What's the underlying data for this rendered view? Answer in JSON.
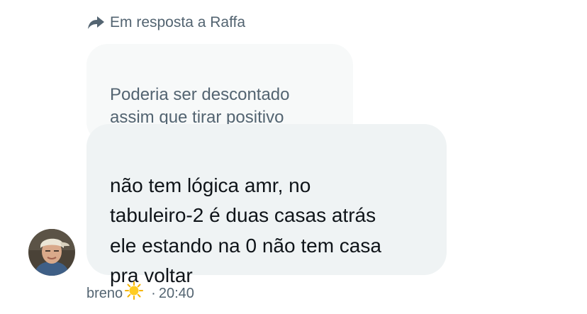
{
  "reply_context": {
    "icon": "reply-arrow-icon",
    "text": "Em resposta a Raffa"
  },
  "quoted_message": {
    "text": "Poderia ser descontado\nassim que tirar positivo"
  },
  "message": {
    "text": "não tem lógica amr, no\ntabuleiro-2 é duas casas atrás\nele estando na 0 não tem casa\npra voltar"
  },
  "sender": {
    "name": "breno",
    "emoji_icon": "sun-icon",
    "separator": "·",
    "time": "20:40"
  },
  "colors": {
    "secondary_text": "#536471",
    "primary_text": "#0f1419",
    "bubble_received": "#eff3f4",
    "bubble_quoted": "#f7f9f9"
  }
}
